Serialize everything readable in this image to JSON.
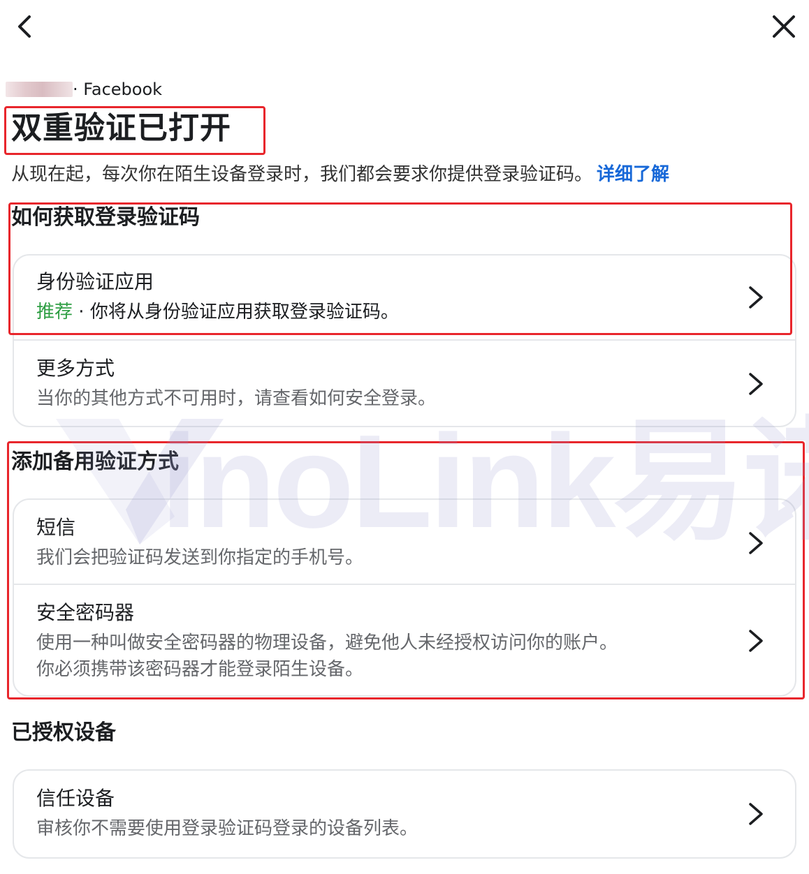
{
  "header": {
    "breadcrumb_app": "· Facebook",
    "title": "双重验证已打开",
    "description": "从现在起，每次你在陌生设备登录时，我们都会要求你提供登录验证码。",
    "learn_more": "详细了解"
  },
  "sections": {
    "get_code": {
      "title": "如何获取登录验证码",
      "items": [
        {
          "title": "身份验证应用",
          "tag": "推荐",
          "sep": " · ",
          "desc": "你将从身份验证应用获取登录验证码。"
        },
        {
          "title": "更多方式",
          "desc": "当你的其他方式不可用时，请查看如何安全登录。"
        }
      ]
    },
    "backup": {
      "title": "添加备用验证方式",
      "items": [
        {
          "title": "短信",
          "desc": "我们会把验证码发送到你指定的手机号。"
        },
        {
          "title": "安全密码器",
          "desc_line1": "使用一种叫做安全密码器的物理设备，避免他人未经授权访问你的账户。",
          "desc_line2": "你必须携带该密码器才能登录陌生设备。"
        }
      ]
    },
    "authorized": {
      "title": "已授权设备",
      "items": [
        {
          "title": "信任设备",
          "desc": "审核你不需要使用登录验证码登录的设备列表。"
        }
      ]
    }
  },
  "watermark": {
    "text": "inoLink易诺"
  },
  "icons": {
    "back": "back-arrow-icon",
    "close": "close-icon",
    "chevron": "chevron-right-icon"
  },
  "colors": {
    "link": "#1768d8",
    "recommend": "#2f9e44",
    "highlight": "#e8262c"
  }
}
